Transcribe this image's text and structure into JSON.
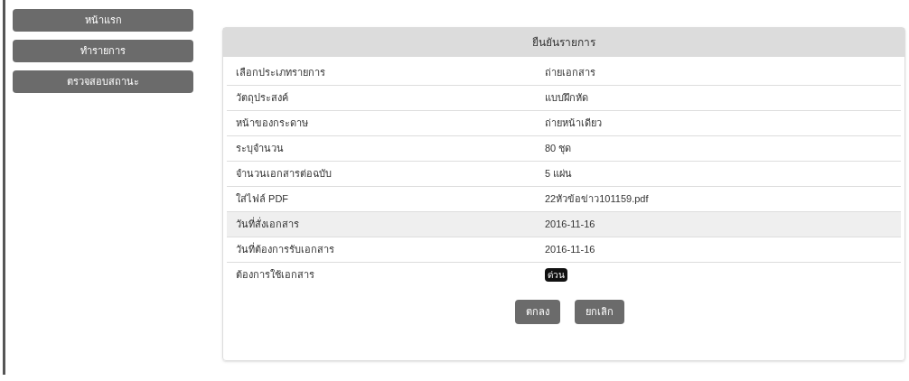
{
  "sidebar": {
    "items": [
      {
        "label": "หน้าแรก"
      },
      {
        "label": "ทำรายการ"
      },
      {
        "label": "ตรวจสอบสถานะ"
      }
    ]
  },
  "panel": {
    "title": "ยืนยันรายการ",
    "rows": [
      {
        "label": "เลือกประเภทรายการ",
        "value": "ถ่ายเอกสาร",
        "kind": "text",
        "highlighted": false
      },
      {
        "label": "วัตถุประสงค์",
        "value": "แบบฝึกหัด",
        "kind": "text",
        "highlighted": false
      },
      {
        "label": "หน้าของกระดาษ",
        "value": "ถ่ายหน้าเดียว",
        "kind": "text",
        "highlighted": false
      },
      {
        "label": "ระบุจำนวน",
        "value": "80 ชุด",
        "kind": "text",
        "highlighted": false
      },
      {
        "label": "จำนวนเอกสารต่อฉบับ",
        "value": "5 แผ่น",
        "kind": "text",
        "highlighted": false
      },
      {
        "label": "ใส่ไฟล์ PDF",
        "value": "22หัวข้อข่าว101159.pdf",
        "kind": "text",
        "highlighted": false
      },
      {
        "label": "วันที่สั่งเอกสาร",
        "value": "2016-11-16",
        "kind": "text",
        "highlighted": true
      },
      {
        "label": "วันที่ต้องการรับเอกสาร",
        "value": "2016-11-16",
        "kind": "text",
        "highlighted": false
      },
      {
        "label": "ต้องการใช้เอกสาร",
        "value": "ด่วน",
        "kind": "badge",
        "highlighted": false
      }
    ],
    "buttons": [
      "ตกลง",
      "ยกเลิก"
    ]
  }
}
